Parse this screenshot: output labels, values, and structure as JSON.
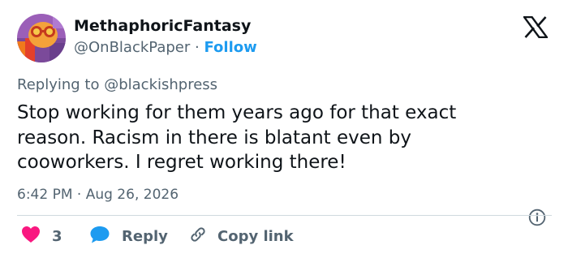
{
  "author": {
    "display_name": "MethaphoricFantasy",
    "handle": "@OnBlackPaper",
    "separator": "·",
    "follow_label": "Follow"
  },
  "reply_context": {
    "prefix": "Replying to",
    "mention": "@blackishpress"
  },
  "tweet": {
    "text": "Stop working for them years ago for that exact\nreason. Racism in there is blatant even by\ncooworkers. I regret working there!",
    "timestamp": "6:42 PM · Aug 26, 2026"
  },
  "actions": {
    "like_count": "3",
    "reply_label": "Reply",
    "copy_link_label": "Copy link"
  },
  "icons": {
    "logo": "x-logo-icon",
    "info": "info-icon",
    "like": "heart-icon",
    "reply": "speech-bubble-icon",
    "copy": "link-icon"
  },
  "colors": {
    "text_primary": "#0f1419",
    "text_secondary": "#536471",
    "accent": "#1d9bf0",
    "like": "#f91880",
    "divider": "#cfd9de"
  }
}
